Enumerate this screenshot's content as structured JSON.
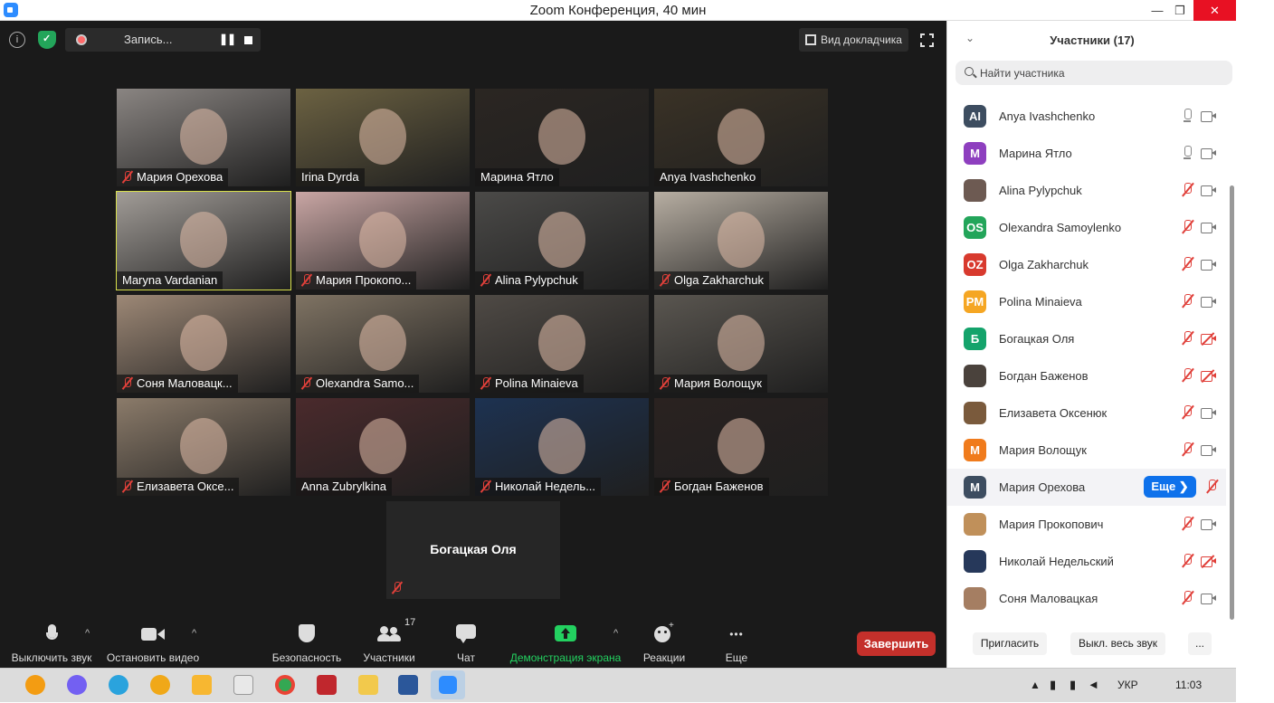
{
  "window": {
    "title": "Zoom Конференция, 40 мин",
    "minimize": "—",
    "maximize": "❐",
    "close": "✕"
  },
  "topbar": {
    "record_label": "Запись...",
    "pause_glyph": "❚❚",
    "speaker_view": "Вид докладчика",
    "info_glyph": "i"
  },
  "tiles": [
    {
      "name": "Мария Орехова",
      "muted": true,
      "bg": "#8a8582"
    },
    {
      "name": "Irina Dyrda",
      "muted": false,
      "bg": "#6c6242"
    },
    {
      "name": "Марина Ятло",
      "muted": false,
      "bg": "#2b2622"
    },
    {
      "name": "Anya Ivashchenko",
      "muted": false,
      "bg": "#3a3226"
    },
    {
      "name": "Maryna Vardanian",
      "muted": false,
      "bg": "#a19c97",
      "active": true
    },
    {
      "name": "Мария Прокопо...",
      "muted": true,
      "bg": "#c9a6a4"
    },
    {
      "name": "Alina Pylypchuk",
      "muted": true,
      "bg": "#4b4a48"
    },
    {
      "name": "Olga Zakharchuk",
      "muted": true,
      "bg": "#b7aea2"
    },
    {
      "name": "Соня Маловацк...",
      "muted": true,
      "bg": "#9d8876"
    },
    {
      "name": "Olexandra Samo...",
      "muted": true,
      "bg": "#7f7363"
    },
    {
      "name": "Polina Minaieva",
      "muted": true,
      "bg": "#4f4a45"
    },
    {
      "name": "Мария Волощук",
      "muted": true,
      "bg": "#5a5650"
    },
    {
      "name": "Елизавета Оксе...",
      "muted": true,
      "bg": "#8b7b6a"
    },
    {
      "name": "Anna Zubrylkina",
      "muted": false,
      "bg": "#4a2a2c"
    },
    {
      "name": "Николай Недель...",
      "muted": true,
      "bg": "#1d3251"
    },
    {
      "name": "Богдан Баженов",
      "muted": true,
      "bg": "#2a2220"
    }
  ],
  "no_video_tile": {
    "name": "Богацкая Оля"
  },
  "toolbar": {
    "mute": "Выключить звук",
    "stop_video": "Остановить видео",
    "security": "Безопасность",
    "participants": "Участники",
    "participants_count": "17",
    "chat": "Чат",
    "share": "Демонстрация экрана",
    "reactions": "Реакции",
    "more": "Еще",
    "end": "Завершить",
    "caret": "^",
    "more_glyph": "•••"
  },
  "panel": {
    "title": "Участники (17)",
    "search_placeholder": "Найти участника",
    "more_button": "Еще ❯",
    "invite": "Пригласить",
    "mute_all": "Выкл. весь звук",
    "ellipsis": "...",
    "participants": [
      {
        "initials": "AI",
        "name": "Anya Ivashchenko",
        "color": "#3d4d60",
        "mic": "on",
        "cam": "on"
      },
      {
        "initials": "M",
        "name": "Марина Ятло",
        "color": "#8e3fbf",
        "mic": "on",
        "cam": "on"
      },
      {
        "initials": "",
        "name": "Alina Pylypchuk",
        "color": "#6d5a52",
        "mic": "off",
        "cam": "on"
      },
      {
        "initials": "OS",
        "name": "Olexandra Samoylenko",
        "color": "#23a55a",
        "mic": "off",
        "cam": "on"
      },
      {
        "initials": "OZ",
        "name": "Olga Zakharchuk",
        "color": "#d83a2e",
        "mic": "off",
        "cam": "on"
      },
      {
        "initials": "PM",
        "name": "Polina Minaieva",
        "color": "#f5a623",
        "mic": "off",
        "cam": "on"
      },
      {
        "initials": "Б",
        "name": "Богацкая Оля",
        "color": "#14a36b",
        "mic": "off",
        "cam": "off"
      },
      {
        "initials": "",
        "name": "Богдан Баженов",
        "color": "#4a423c",
        "mic": "off",
        "cam": "off"
      },
      {
        "initials": "",
        "name": "Елизавета Оксенюк",
        "color": "#7a5a3c",
        "mic": "off",
        "cam": "on"
      },
      {
        "initials": "M",
        "name": "Мария Волощук",
        "color": "#f07b1c",
        "mic": "off",
        "cam": "on"
      },
      {
        "initials": "M",
        "name": "Мария Орехова",
        "color": "#3d4d60",
        "mic": "off",
        "cam": "none",
        "highlight": true
      },
      {
        "initials": "",
        "name": "Мария Прокопович",
        "color": "#c0905a",
        "mic": "off",
        "cam": "on"
      },
      {
        "initials": "",
        "name": "Николай Недельский",
        "color": "#26385a",
        "mic": "off",
        "cam": "off"
      },
      {
        "initials": "",
        "name": "Соня Маловацкая",
        "color": "#a57e62",
        "mic": "off",
        "cam": "on"
      }
    ]
  },
  "taskbar": {
    "lang": "УКР",
    "time": "11:03"
  }
}
